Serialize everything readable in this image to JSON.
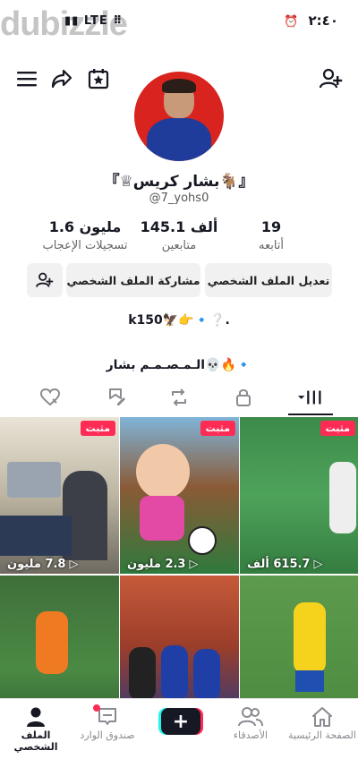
{
  "status_bar": {
    "left_text": "LTE",
    "time": "٢:٤٠",
    "watermark": "dubizzle"
  },
  "profile": {
    "name": "『♕بشار كريس🐐』",
    "handle": "@7_yohs0",
    "stats": [
      {
        "value": "19",
        "label": "أتابعه"
      },
      {
        "value": "145.1 ألف",
        "label": "متابعين"
      },
      {
        "value": "1.6 مليون",
        "label": "تسجيلات الإعجاب"
      }
    ],
    "buttons": {
      "edit": "تعديل الملف الشخصي",
      "share": "مشاركة الملف الشخصي"
    },
    "bio_line1": "k150🦅👉🔹❔.",
    "bio_line2": "الـمـصـمـم بشار💀🔥🔹"
  },
  "videos": [
    {
      "pinned": "مثبت",
      "views": "7.8 مليون"
    },
    {
      "pinned": "مثبت",
      "views": "2.3 مليون"
    },
    {
      "pinned": "مثبت",
      "views": "615.7 ألف"
    },
    {
      "pinned": "",
      "views": ""
    },
    {
      "pinned": "",
      "views": ""
    },
    {
      "pinned": "",
      "views": ""
    }
  ],
  "bottom_nav": {
    "profile": "الملف الشخصي",
    "inbox": "صندوق الوارد",
    "friends": "الأصدقاء",
    "home": "الصفحة الرئيسية"
  },
  "colors": {
    "accent": "#fe2c55",
    "cyan": "#25f4ee",
    "text": "#161823"
  }
}
